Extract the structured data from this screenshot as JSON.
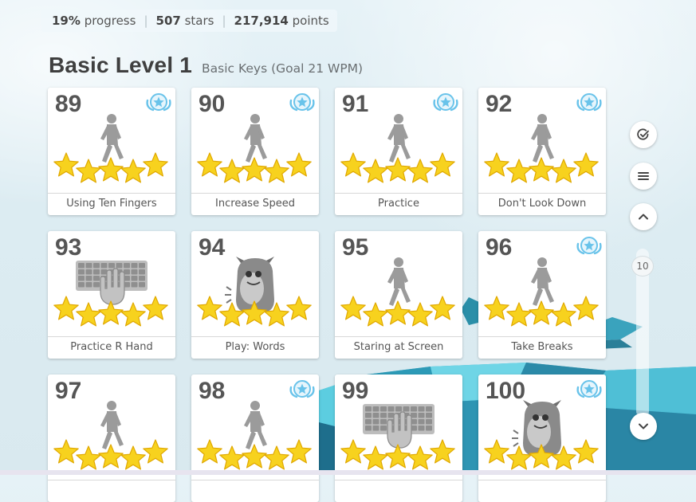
{
  "stats": {
    "progress_value": "19%",
    "progress_label": "progress",
    "stars_value": "507",
    "stars_label": "stars",
    "points_value": "217,914",
    "points_label": "points"
  },
  "level": {
    "title": "Basic Level 1",
    "subtitle": "Basic Keys (Goal 21 WPM)"
  },
  "lessons": [
    {
      "number": "89",
      "title": "Using Ten Fingers",
      "icon": "walking-person-icon",
      "badge": true,
      "stars": 5
    },
    {
      "number": "90",
      "title": "Increase Speed",
      "icon": "walking-person-icon",
      "badge": true,
      "stars": 5
    },
    {
      "number": "91",
      "title": "Practice",
      "icon": "walking-person-icon",
      "badge": true,
      "stars": 5
    },
    {
      "number": "92",
      "title": "Don't Look Down",
      "icon": "walking-person-icon",
      "badge": true,
      "stars": 5
    },
    {
      "number": "93",
      "title": "Practice R Hand",
      "icon": "keyboard-hand-icon",
      "badge": false,
      "stars": 5
    },
    {
      "number": "94",
      "title": "Play: Words",
      "icon": "monster-icon",
      "badge": false,
      "stars": 5
    },
    {
      "number": "95",
      "title": "Staring at Screen",
      "icon": "walking-person-icon",
      "badge": false,
      "stars": 5
    },
    {
      "number": "96",
      "title": "Take Breaks",
      "icon": "walking-person-icon",
      "badge": true,
      "stars": 5
    },
    {
      "number": "97",
      "title": "",
      "icon": "walking-person-icon",
      "badge": false,
      "stars": 5
    },
    {
      "number": "98",
      "title": "",
      "icon": "walking-person-icon",
      "badge": true,
      "stars": 5
    },
    {
      "number": "99",
      "title": "",
      "icon": "keyboard-hand-icon",
      "badge": false,
      "stars": 5
    },
    {
      "number": "100",
      "title": "",
      "icon": "monster-icon",
      "badge": true,
      "stars": 5
    }
  ],
  "sidebar": {
    "buttons": [
      {
        "icon": "check-circle-icon"
      },
      {
        "icon": "menu-icon"
      },
      {
        "icon": "chevron-up-icon"
      },
      {
        "icon": "chevron-down-icon"
      }
    ],
    "scroll_level": "10"
  },
  "colors": {
    "star_fill": "#f7d21e",
    "star_stroke": "#e0a800",
    "badge_blue": "#69c3ea",
    "icon_gray": "#9b9b9b",
    "title_text": "#3f3f3f"
  }
}
